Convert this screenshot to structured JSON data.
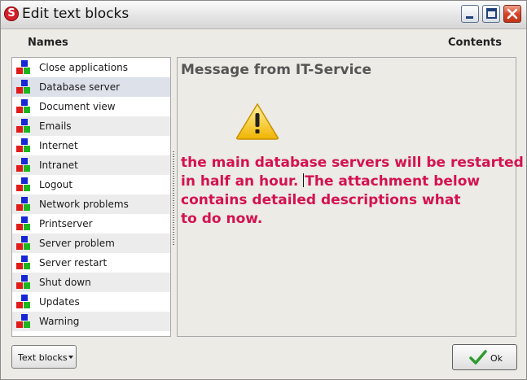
{
  "window": {
    "title": "Edit text blocks",
    "app_icon_letter": "S"
  },
  "columns": {
    "names_label": "Names",
    "contents_label": "Contents"
  },
  "names_list": {
    "items": [
      {
        "label": "Close applications"
      },
      {
        "label": "Database server",
        "selected": true
      },
      {
        "label": "Document view"
      },
      {
        "label": "Emails"
      },
      {
        "label": "Internet"
      },
      {
        "label": "Intranet"
      },
      {
        "label": "Logout"
      },
      {
        "label": "Network problems"
      },
      {
        "label": "Printserver"
      },
      {
        "label": "Server problem"
      },
      {
        "label": "Server restart"
      },
      {
        "label": "Shut down"
      },
      {
        "label": "Updates"
      },
      {
        "label": "Warning"
      }
    ]
  },
  "content": {
    "title": "Message from IT-Service",
    "icon": "warning-icon",
    "lines": [
      "the main database servers will be restarted",
      "in half an hour. ",
      "The attachment below",
      "contains detailed descriptions what",
      "to do now."
    ],
    "text_color": "#d4124f"
  },
  "footer": {
    "text_blocks_label": "Text blocks",
    "ok_label": "Ok"
  }
}
